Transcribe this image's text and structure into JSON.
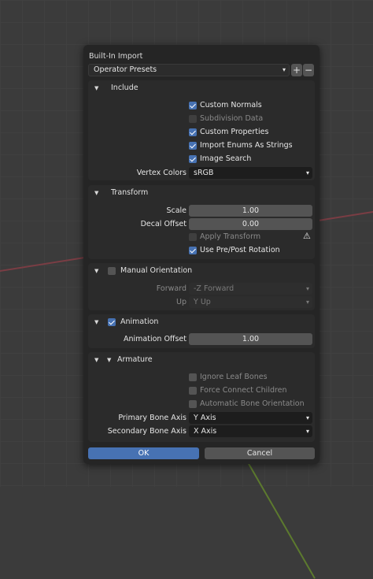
{
  "dialog": {
    "title": "Built-In Import",
    "presets": {
      "label": "Operator Presets",
      "add": "+",
      "remove": "−"
    }
  },
  "include": {
    "title": "Include",
    "options": [
      {
        "label": "Custom Normals",
        "checked": true,
        "enabled": true
      },
      {
        "label": "Subdivision Data",
        "checked": false,
        "enabled": false
      },
      {
        "label": "Custom Properties",
        "checked": true,
        "enabled": true
      },
      {
        "label": "Import Enums As Strings",
        "checked": true,
        "enabled": true
      },
      {
        "label": "Image Search",
        "checked": true,
        "enabled": true
      }
    ],
    "vertex_colors": {
      "label": "Vertex Colors",
      "value": "sRGB"
    }
  },
  "transform": {
    "title": "Transform",
    "scale": {
      "label": "Scale",
      "value": "1.00"
    },
    "decal_offset": {
      "label": "Decal Offset",
      "value": "0.00"
    },
    "apply_transform": {
      "label": "Apply Transform",
      "checked": false
    },
    "use_pre_post_rotation": {
      "label": "Use Pre/Post Rotation",
      "checked": true
    },
    "warning_icon": "warning-icon"
  },
  "manual_orientation": {
    "title": "Manual Orientation",
    "checked": false,
    "forward": {
      "label": "Forward",
      "value": "-Z Forward"
    },
    "up": {
      "label": "Up",
      "value": "Y Up"
    }
  },
  "animation": {
    "title": "Animation",
    "checked": true,
    "offset": {
      "label": "Animation Offset",
      "value": "1.00"
    }
  },
  "armature": {
    "title": "Armature",
    "options": [
      {
        "label": "Ignore Leaf Bones",
        "checked": false
      },
      {
        "label": "Force Connect Children",
        "checked": false
      },
      {
        "label": "Automatic Bone Orientation",
        "checked": false
      }
    ],
    "primary_bone_axis": {
      "label": "Primary Bone Axis",
      "value": "Y Axis"
    },
    "secondary_bone_axis": {
      "label": "Secondary Bone Axis",
      "value": "X Axis"
    }
  },
  "buttons": {
    "ok": "OK",
    "cancel": "Cancel"
  },
  "colors": {
    "accent": "#4772b3",
    "panel": "#2b2b2b",
    "dialog": "#252525",
    "field": "#545454"
  }
}
